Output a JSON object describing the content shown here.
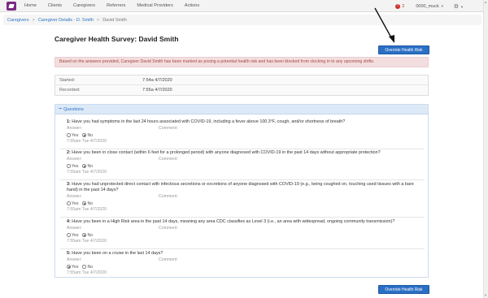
{
  "nav": {
    "links": [
      "Home",
      "Clients",
      "Caregivers",
      "Referrers",
      "Medical Providers",
      "Actions"
    ],
    "alert_count": "2",
    "user": "0000_muck"
  },
  "breadcrumb": {
    "items": [
      "Caregivers",
      "Caregiver Details - D. Smith"
    ],
    "current": "David Smith"
  },
  "page": {
    "title": "Caregiver Health Survey: David Smith",
    "override_button": "Override Health Risk",
    "alert": "Based on the answers provided, Caregiver David Smith has been marked as posing a potential health risk and has been blocked from clocking in to any upcoming shifts."
  },
  "info": [
    {
      "label": "Started:",
      "value": "7:54a 4/7/2020"
    },
    {
      "label": "Recorded:",
      "value": "7:55a 4/7/2020"
    }
  ],
  "questions_panel": {
    "title": "Questions",
    "answer_label": "Answer:",
    "comment_label": "Comment:",
    "yes_label": "Yes",
    "no_label": "No",
    "items": [
      {
        "num": "1:",
        "text": "Have you had symptoms in the last 24 hours associated with COVID-19, including a fever above 100.3°F, cough, and/or shortness of breath?",
        "answer": "No",
        "time": "7:55am Tue 4/7/2020"
      },
      {
        "num": "2:",
        "text": "Have you been in close contact (within 6 feet for a prolonged period) with anyone diagnosed with COVID-19 in the past 14 days without appropriate protection?",
        "answer": "No",
        "time": "7:55am Tue 4/7/2020"
      },
      {
        "num": "3:",
        "text": "Have you had unprotected direct contact with infectious secretions or excretions of anyone diagnosed with COVID-19 (e.g., being coughed on, touching used tissues with a bare hand) in the past 14 days?",
        "answer": "No",
        "time": "7:55am Tue 4/7/2020"
      },
      {
        "num": "4:",
        "text": "Have you been in a High Risk area in the past 14 days, meaning any area CDC classifies as Level 3 (i.e., an area with widespread, ongoing community transmission)?",
        "answer": "No",
        "time": "7:55am Tue 4/7/2020"
      },
      {
        "num": "5:",
        "text": "Have you been on a cruise in the last 14 days?",
        "answer": "Yes",
        "time": "7:55am Tue 4/7/2020"
      }
    ]
  },
  "colors": {
    "brand": "#7b2a83",
    "primary": "#2a6fc4",
    "danger_bg": "#f2dede",
    "danger_text": "#a94442"
  }
}
